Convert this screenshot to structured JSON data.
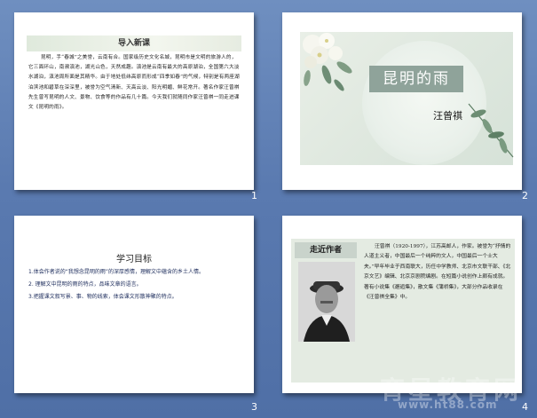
{
  "slide1": {
    "title": "导入新课",
    "body": "昆明，手“春城”之美誉，云南有合。国家级历史文化名城，昆明市是文明的旅游人的，它三面环山，南濒滇池，湖光山色，天然成趣。滇池是云南有最大的高原湖泊，全国第六大淡水湖泊，滇池周所面是其精华。由于地处低纬高原而形成“四季如春”的气候，特别是有两座湖泊滨池和碧草在深深里，被誉为空气清新、天高云淡、阳光明媚、鲜花常开。著名作家汪曾祺先生曾写昆明的人文、景物、饮食等的作品有几十篇。今天我们就随同作家汪曾祺一同走进课文《昆明的雨》。",
    "number": "1"
  },
  "slide2": {
    "title": "昆明的雨",
    "author": "汪曾祺",
    "number": "2"
  },
  "slide3": {
    "title": "学习目标",
    "items": [
      "1.体会作者说的“我想念昆明的雨”的深厚感情，理解文中蕴含的乡土人情。",
      "2. 理解文中昆明的雨的特点，品味文章的语言。",
      "3.把握课文叙写景、事、物的线索，体会课文形散神聚的特点。"
    ],
    "number": "3"
  },
  "slide4": {
    "heading": "走近作者",
    "text": "汪曾祺（1920-1997），江苏高邮人，作家。被誉为“抒情的人道主义者，中国最后一个纯粹的文人，中国最后一个士大夫。”早年毕业于西南联大，历任中学教师、北京市文联干部、《北京文艺》编辑、北京京剧院编剧。在短篇小说创作上颇有成就。著有小说集《邂逅集》，散文集《蒲桥集》，大部分作品收录在《汪曾祺全集》中。",
    "number": "4"
  },
  "watermark": {
    "line1": "育星教育网",
    "line2": "www.ht88.com"
  }
}
